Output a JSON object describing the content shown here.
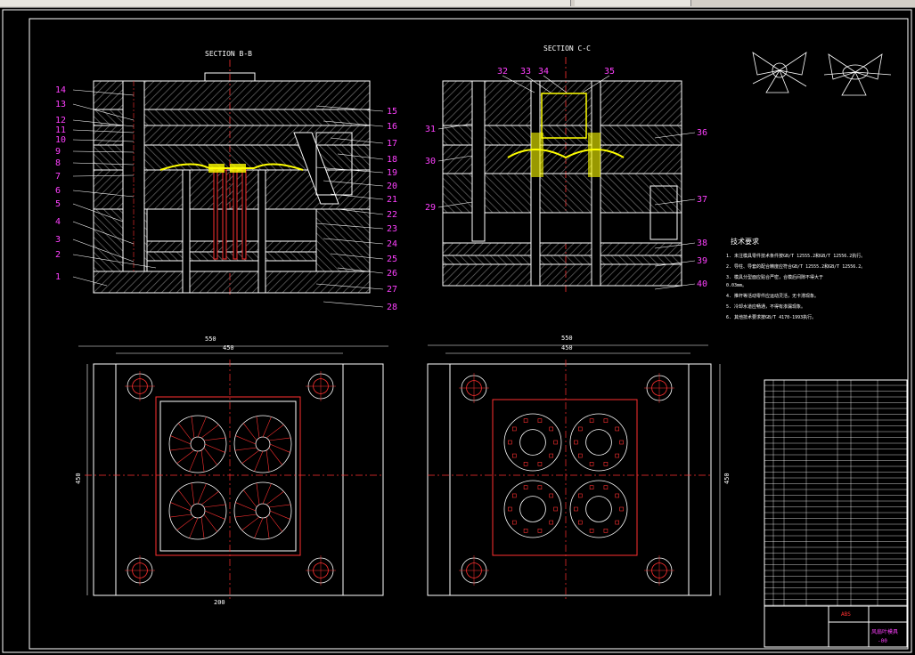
{
  "window": {
    "title": ""
  },
  "drawing": {
    "section_bb": "SECTION  B-B",
    "section_cc": "SECTION  C-C",
    "left_callouts": [
      "14",
      "13",
      "12",
      "11",
      "10",
      "9",
      "8",
      "7",
      "6",
      "5",
      "4",
      "3",
      "2",
      "1"
    ],
    "mid_callouts": [
      "15",
      "16",
      "17",
      "18",
      "19",
      "20",
      "21",
      "22",
      "23",
      "24",
      "25",
      "26",
      "27",
      "28"
    ],
    "top_callouts": [
      "32",
      "33",
      "34",
      "35"
    ],
    "right_callouts_left": [
      "31",
      "30",
      "29"
    ],
    "right_callouts": [
      "36",
      "37",
      "38",
      "39",
      "40"
    ],
    "dim_550_left": "550",
    "dim_450_left": "450",
    "dim_450_side_left": "450",
    "dim_550_right": "550",
    "dim_450_right": "450",
    "dim_450_side_right": "450",
    "dim_bottom_left": "200",
    "tech_title": "技术要求",
    "tech_notes": [
      "1. 未注模具零件技术条件按GB/T 12555.2和GB/T 12556.2执行。",
      "2. 导柱、导套的配合精度应符合GB/T 12555.2和GB/T 12556.2。",
      "3. 模具分型面应贴合严密，合模后间隙不得大于",
      "   0.03mm。",
      "4. 推杆等活动零件应运动灵活，无卡滞现象。",
      "5. 冷却水道应畅通，不得有渗漏现象。",
      "6. 其他技术要求按GB/T 4170-1993执行。"
    ],
    "title_block": {
      "material": "ABS",
      "name": "风扇叶模具",
      "code": "-00"
    }
  },
  "colors": {
    "outline": "#ffffff",
    "centerline": "#ff3030",
    "callout": "#ff40ff",
    "hatch": "#7a7a7a",
    "part": "#ffff00",
    "dim": "#ffffff"
  }
}
